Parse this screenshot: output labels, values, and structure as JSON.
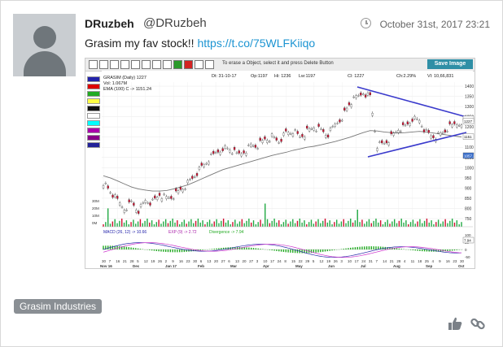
{
  "post": {
    "display_name": "DRuzbeh",
    "handle": "@DRuzbeh",
    "timestamp": "October 31st, 2017 23:21",
    "text_prefix": "Grasim my fav stock!! ",
    "link": "https://t.co/75WLFKiiqo"
  },
  "chart_toolbar": {
    "message": "To erase a Object, select it and press Delete Button",
    "save_label": "Save Image"
  },
  "chart_stats": {
    "dt": "Dt: 31-10-17",
    "op": "Op:1197",
    "hi": "Hi: 1236",
    "lw": "Lw:1197",
    "cl": "Cl: 1227",
    "ch": "Ch:2.29%",
    "vl": "Vl: 10,66,831"
  },
  "chart_legend": {
    "line1": "GRASIM (Daily) 1227",
    "line2": "Vol: 1.067M",
    "line3": "EMA (100) C -> 1151.24"
  },
  "macd_legend": {
    "macd": "MACD (26, 12) -> 10.66",
    "exp": "EXP (9) -> 2.72",
    "divergence": "Divergence -> 7.94"
  },
  "palette_colors": [
    "#2222aa",
    "#dd0000",
    "#22aa22",
    "#ffff44",
    "#111111",
    "#ffffff",
    "#00ffff",
    "#aa00aa",
    "#880088",
    "#222299"
  ],
  "chart_data": {
    "type": "line",
    "title": "GRASIM (Daily) 1227",
    "x_tick_labels": [
      "30",
      "7",
      "16",
      "21",
      "28",
      "5",
      "12",
      "19",
      "26",
      "2",
      "9",
      "16",
      "23",
      "30",
      "6",
      "13",
      "20",
      "27",
      "6",
      "13",
      "20",
      "27",
      "3",
      "10",
      "17",
      "24",
      "8",
      "15",
      "22",
      "29",
      "5",
      "12",
      "19",
      "26",
      "3",
      "10",
      "17",
      "24",
      "31",
      "7",
      "14",
      "21",
      "28",
      "4",
      "11",
      "18",
      "25",
      "4",
      "9",
      "16",
      "23",
      "30"
    ],
    "month_labels": [
      "Nov 16",
      "Dec",
      "Jan 17",
      "Feb",
      "Mar",
      "Apr",
      "May",
      "Jun",
      "Jul",
      "Aug",
      "Sep",
      "Oct"
    ],
    "y_tick_labels": [
      "1400",
      "1350",
      "1300",
      "1250",
      "1200",
      "1150",
      "1100",
      "1050",
      "1000",
      "950",
      "900",
      "850",
      "800",
      "750"
    ],
    "volume_tick_labels": [
      "30M",
      "20M",
      "10M",
      "0M"
    ],
    "macd_tick_labels": [
      "100",
      "50",
      "0",
      "-50"
    ],
    "price_markers": [
      "1237",
      "1227",
      "1151",
      "1057.2"
    ],
    "ylim": [
      750,
      1420
    ],
    "close_series": [
      930,
      880,
      835,
      800,
      830,
      790,
      840,
      830,
      870,
      850,
      860,
      890,
      920,
      960,
      1000,
      1040,
      1070,
      1100,
      1090,
      1060,
      1080,
      1110,
      1110,
      1140,
      1150,
      1130,
      1170,
      1180,
      1150,
      1175,
      1200,
      1180,
      1160,
      1210,
      1250,
      1310,
      1340,
      1370,
      1350,
      1110,
      1120,
      1150,
      1190,
      1200,
      1240,
      1230,
      1170,
      1150,
      1160,
      1190,
      1210,
      1227
    ],
    "ema_series": [
      960,
      950,
      935,
      920,
      905,
      895,
      890,
      885,
      885,
      888,
      895,
      905,
      915,
      930,
      945,
      960,
      975,
      990,
      1000,
      1010,
      1020,
      1030,
      1040,
      1050,
      1060,
      1068,
      1075,
      1085,
      1092,
      1100,
      1105,
      1112,
      1120,
      1128,
      1138,
      1148,
      1160,
      1172,
      1182,
      1180,
      1175,
      1172,
      1170,
      1172,
      1175,
      1178,
      1175,
      1170,
      1165,
      1160,
      1155,
      1151
    ]
  }
}
